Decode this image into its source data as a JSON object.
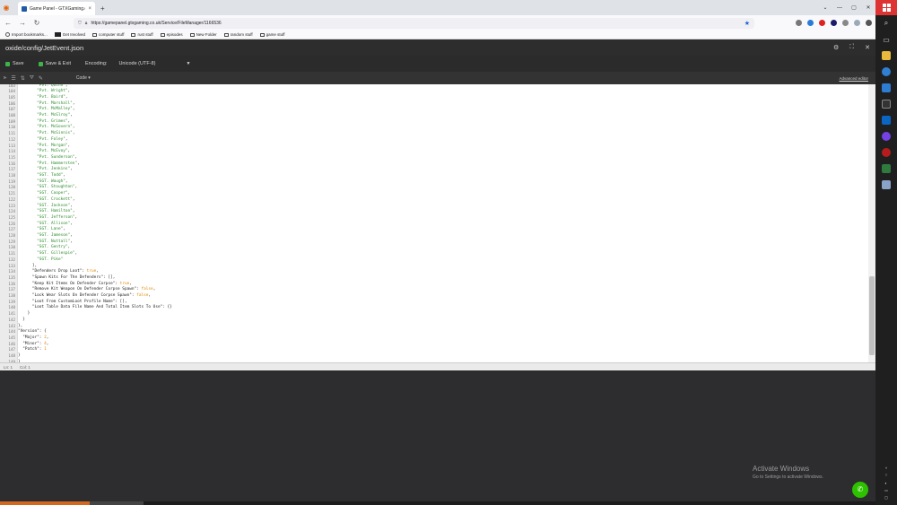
{
  "browser": {
    "tab_title": "Game Panel - GTXGaming.co.",
    "tab_close": "×",
    "new_tab": "+",
    "url": "https://gamepanel.gtxgaming.co.uk/Service/FileManager/1166536",
    "bookmarks": [
      "Import bookmarks...",
      "Get Involved",
      "computer stuff",
      "rust stuff",
      "episodes",
      "New Folder",
      "random stuff",
      "game stuff"
    ]
  },
  "panel": {
    "title": "oxide/config/JetEvent.json"
  },
  "toolbar": {
    "save_label": "Save",
    "save_exit_label": "Save & Exit",
    "encoding_label": "Encoding:",
    "encoding_value": "Unicode (UTF-8)"
  },
  "editor_toolbar": {
    "mode": "Code",
    "advanced": "Advanced editor"
  },
  "code_lines": [
    {
      "n": "103",
      "t": "        \"Pvt. Quinn\","
    },
    {
      "n": "104",
      "t": "        \"Pvt. Wright\","
    },
    {
      "n": "105",
      "t": "        \"Pvt. Baird\","
    },
    {
      "n": "106",
      "t": "        \"Pvt. Marshall\","
    },
    {
      "n": "107",
      "t": "        \"Pvt. McMalley\","
    },
    {
      "n": "108",
      "t": "        \"Pvt. McGlroy\","
    },
    {
      "n": "109",
      "t": "        \"Pvt. Grimes\","
    },
    {
      "n": "110",
      "t": "        \"Pvt. McGovern\","
    },
    {
      "n": "111",
      "t": "        \"Pvt. McGinnis\","
    },
    {
      "n": "112",
      "t": "        \"Pvt. Foley\","
    },
    {
      "n": "113",
      "t": "        \"Pvt. Morgan\","
    },
    {
      "n": "114",
      "t": "        \"Pvt. McEvoy\","
    },
    {
      "n": "115",
      "t": "        \"Pvt. Sunderson\","
    },
    {
      "n": "116",
      "t": "        \"Pvt. Hammersten\","
    },
    {
      "n": "117",
      "t": "        \"Pvt. Jenkins\","
    },
    {
      "n": "118",
      "t": "        \"SGT. Todd\","
    },
    {
      "n": "119",
      "t": "        \"SGT. Waugh\","
    },
    {
      "n": "120",
      "t": "        \"SGT. Stoughton\","
    },
    {
      "n": "121",
      "t": "        \"SGT. Cooper\","
    },
    {
      "n": "122",
      "t": "        \"SGT. Crockett\","
    },
    {
      "n": "123",
      "t": "        \"SGT. Jackson\","
    },
    {
      "n": "124",
      "t": "        \"SGT. Hamilton\","
    },
    {
      "n": "125",
      "t": "        \"SGT. Jefferson\","
    },
    {
      "n": "126",
      "t": "        \"SGT. Allison\","
    },
    {
      "n": "127",
      "t": "        \"SGT. Lane\","
    },
    {
      "n": "128",
      "t": "        \"SGT. Jameson\","
    },
    {
      "n": "129",
      "t": "        \"SGT. Nuttall\","
    },
    {
      "n": "130",
      "t": "        \"SGT. Gentry\","
    },
    {
      "n": "131",
      "t": "        \"SGT. Gillespie\","
    },
    {
      "n": "132",
      "t": "        \"SGT. Pike\""
    },
    {
      "n": "133",
      "t": "      ],"
    },
    {
      "n": "134",
      "t": "      \"Defenders Drop Loot\": true,"
    },
    {
      "n": "135",
      "t": "      \"Spawn Kits For The Defenders\": [],"
    },
    {
      "n": "136",
      "t": "      \"Keep Kit Items On Defender Corpse\": true,"
    },
    {
      "n": "137",
      "t": "      \"Remove Kit Weapon On Defender Corpse Spawn\": false,"
    },
    {
      "n": "138",
      "t": "      \"Lock Wear Slots On Defender Corpse Spawn\": false,"
    },
    {
      "n": "139",
      "t": "      \"Loot From CustomLoot Profile Name\": [],"
    },
    {
      "n": "140",
      "t": "      \"Loot Table Data File Name And Total Item Slots To Use\": {}"
    },
    {
      "n": "141",
      "t": "    }"
    },
    {
      "n": "142",
      "t": "  }"
    },
    {
      "n": "143",
      "t": "},"
    },
    {
      "n": "144",
      "t": "\"Version\": {"
    },
    {
      "n": "145",
      "t": "  \"Major\": 2,"
    },
    {
      "n": "146",
      "t": "  \"Minor\": 4,"
    },
    {
      "n": "147",
      "t": "  \"Patch\": 1"
    },
    {
      "n": "148",
      "t": "}"
    },
    {
      "n": "149",
      "t": "}"
    }
  ],
  "status": {
    "ln": "Ln: 1",
    "col": "Col: 1"
  },
  "watermark": {
    "line1": "Activate Windows",
    "line2": "Go to Settings to activate Windows."
  },
  "colors": {
    "string": "#2a8a2a",
    "boolean_number": "#e08a00",
    "save_icon": "#3db34a"
  }
}
